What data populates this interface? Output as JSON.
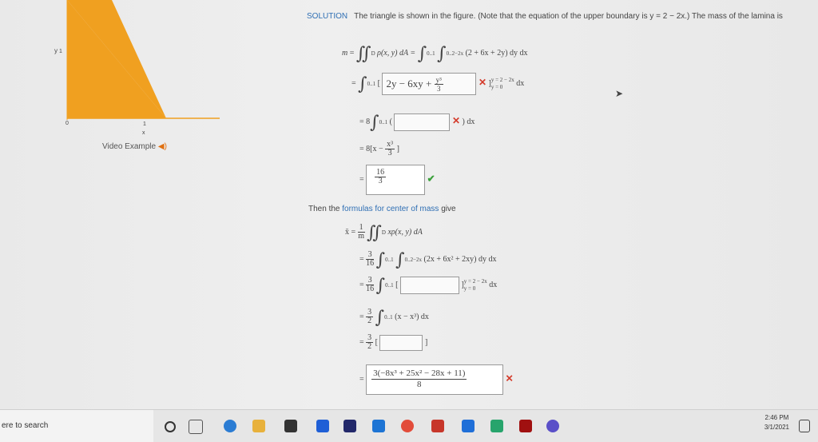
{
  "graph": {
    "y_label": "y",
    "y_tick": "1",
    "x_tick": "1",
    "x_label": "x",
    "origin": "0"
  },
  "video": {
    "label": "Video Example"
  },
  "solution": {
    "keyword": "SOLUTION",
    "intro": "The triangle is shown in the figure. (Note that the equation of the upper boundary is y = 2 − 2x.) The mass of the lamina is",
    "m_line": "ρ(x, y) dA =",
    "m_integrand": "(2 + 6x + 2y) dy dx",
    "line2_inner": "2y − 6xy +",
    "line2_frac_num": "y³",
    "line2_frac_den": "3",
    "line2_bounds_top": "y = 2 − 2x",
    "line2_bounds_bot": "y = 0",
    "dx": "dx",
    "line3_coef": "8",
    "line4": "= 8[x −",
    "line4_frac_num": "x³",
    "line4_frac_den": "3",
    "answer_num": "16",
    "answer_den": "3"
  },
  "center": {
    "intro_a": "Then the",
    "intro_link": "formulas for center of mass",
    "intro_b": "give",
    "xbar": "x̄ =",
    "frac1_num": "1",
    "frac1_den": "m",
    "line1_integrand": "xρ(x, y) dA",
    "coef_num": "3",
    "coef_den": "16",
    "line2_integrand": "(2x + 6x² + 2xy) dy dx",
    "line3_bounds_top": "y = 2 − 2x",
    "line3_bounds_bot": "y = 0",
    "line4_coef_num": "3",
    "line4_coef_den": "2",
    "line4_integrand": "(x − x³) dx",
    "final_num": "3(−8x³ + 25x² − 28x + 11)",
    "final_den": "8"
  },
  "taskbar": {
    "search_text": "ere to search",
    "time": "2:46 PM",
    "date": "3/1/2021"
  },
  "colors": {
    "triangle": "#f0a020",
    "link": "#2f6fb4",
    "wrong": "#d43a2a",
    "right": "#3aa03a"
  }
}
